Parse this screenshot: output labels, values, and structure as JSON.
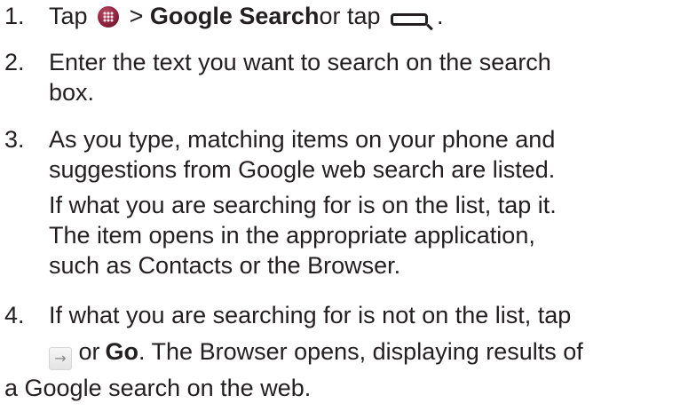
{
  "steps": [
    {
      "num": "1.",
      "pre": "Tap",
      "gt": ">",
      "bold": "Google Search",
      "post": "or tap",
      "end": "."
    },
    {
      "num": "2.",
      "line1": "Enter the text you want to search on the search",
      "line2": "box."
    },
    {
      "num": "3.",
      "line1": "As you type, matching items on your phone and",
      "line2": "suggestions from Google web search are listed.",
      "line3": "If what you are searching for is on the list, tap it.",
      "line4": "The item opens in the appropriate application,",
      "line5": "such as Contacts or the Browser."
    },
    {
      "num": "4.",
      "line1": "If what you are searching for is not on the list, tap",
      "or": "or",
      "bold": "Go",
      "post": ". The Browser opens, displaying results of",
      "line3": "a Google search on the web."
    }
  ],
  "icons": {
    "apps": "apps-launcher-icon",
    "search_key": "search-key-icon",
    "arrow": "arrow-right-icon"
  }
}
